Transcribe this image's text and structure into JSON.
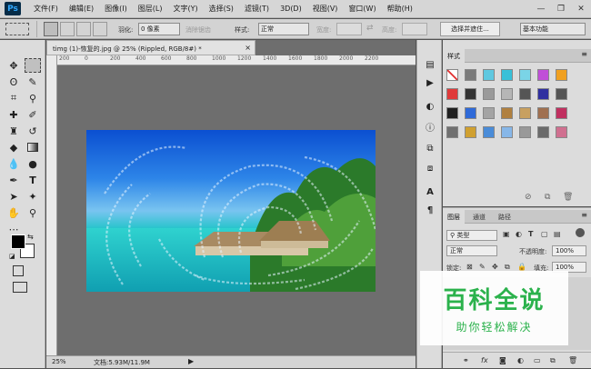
{
  "app": {
    "logo": "Ps"
  },
  "menu": [
    "文件(F)",
    "编辑(E)",
    "图像(I)",
    "图层(L)",
    "文字(Y)",
    "选择(S)",
    "滤镜(T)",
    "3D(D)",
    "视图(V)",
    "窗口(W)",
    "帮助(H)"
  ],
  "window_controls": {
    "minimize": "—",
    "restore": "❐",
    "close": "✕"
  },
  "options": {
    "feather_label": "羽化:",
    "feather_value": "0 像素",
    "antialias": "消除锯齿",
    "style_label": "样式:",
    "style_value": "正常",
    "width_label": "宽度:",
    "height_label": "高度:",
    "select_mask_button": "选择并遮住...",
    "workspace": "基本功能"
  },
  "document": {
    "tab_title": "timg (1)-恢复的.jpg @ 25% (Rippled, RGB/8#) *",
    "close": "×",
    "ruler_labels": [
      "200",
      "0",
      "200",
      "400",
      "600",
      "800",
      "1000",
      "1200",
      "1400",
      "1600",
      "1800",
      "2000",
      "2200"
    ],
    "zoom": "25%",
    "doc_size": "文档:5.93M/11.9M"
  },
  "styles_panel": {
    "tab": "样式",
    "swatch_colors": [
      "#ffffff",
      "#7a7a7a",
      "#5fc8e0",
      "#38c0d8",
      "#7ad4e6",
      "#c04fd8",
      "#f0a020",
      "#e03a3a",
      "#333333",
      "#9a9a9a",
      "#b6b6b6",
      "#555555",
      "#3030a0",
      "#555555",
      "#202020",
      "#2f6ad8",
      "#a4a4a4",
      "#b08040",
      "#c8a060",
      "#a07050",
      "#c03060",
      "#707070",
      "#d0a030",
      "#4a8cd8",
      "#87b7e8",
      "#999999",
      "#6a6a6a",
      "#d07090"
    ]
  },
  "layers_panel": {
    "tabs": [
      "图层",
      "通道",
      "路径"
    ],
    "kind_label": "类型",
    "blend_mode": "正常",
    "opacity_label": "不透明度:",
    "opacity_value": "100%",
    "lock_label": "锁定:",
    "fill_label": "填充:",
    "fill_value": "100%"
  },
  "watermark": {
    "title": "百科全说",
    "subtitle": "助你轻松解决"
  }
}
